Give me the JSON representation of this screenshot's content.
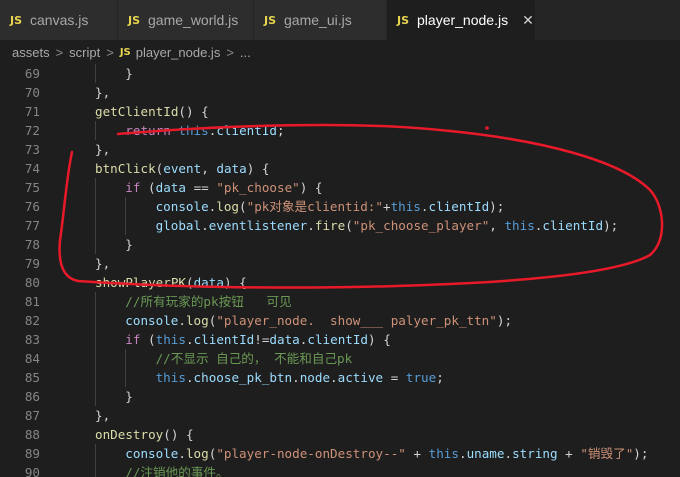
{
  "tabs": [
    {
      "badge": "JS",
      "label": "canvas.js",
      "active": false
    },
    {
      "badge": "JS",
      "label": "game_world.js",
      "active": false
    },
    {
      "badge": "JS",
      "label": "game_ui.js",
      "active": false
    },
    {
      "badge": "JS",
      "label": "player_node.js",
      "active": true,
      "close": "✕"
    }
  ],
  "breadcrumb": {
    "items": [
      "assets",
      "script",
      "player_node.js",
      "..."
    ],
    "separator": ">",
    "badge": "JS"
  },
  "colors": {
    "annotation": "#e81a2a",
    "keyword": "#c586c0",
    "function": "#dcdcaa",
    "string": "#ce9178",
    "comment": "#6a9955",
    "this": "#569cd6",
    "property": "#9cdcfe"
  },
  "code": {
    "lines": [
      {
        "n": "69",
        "indent": 2,
        "tokens": [
          {
            "t": "}",
            "c": "plain"
          }
        ]
      },
      {
        "n": "70",
        "indent": 1,
        "tokens": [
          {
            "t": "},",
            "c": "plain"
          }
        ]
      },
      {
        "n": "71",
        "indent": 1,
        "tokens": [
          {
            "t": "getClientId",
            "c": "fn"
          },
          {
            "t": "() {",
            "c": "plain"
          }
        ]
      },
      {
        "n": "72",
        "indent": 2,
        "tokens": [
          {
            "t": "return",
            "c": "kw"
          },
          {
            "t": " ",
            "c": "plain"
          },
          {
            "t": "this",
            "c": "this"
          },
          {
            "t": ".",
            "c": "plain"
          },
          {
            "t": "clientId",
            "c": "prop"
          },
          {
            "t": ";",
            "c": "plain"
          }
        ]
      },
      {
        "n": "73",
        "indent": 1,
        "tokens": [
          {
            "t": "},",
            "c": "plain"
          }
        ]
      },
      {
        "n": "74",
        "indent": 1,
        "tokens": [
          {
            "t": "btnClick",
            "c": "fn"
          },
          {
            "t": "(",
            "c": "plain"
          },
          {
            "t": "event",
            "c": "prop"
          },
          {
            "t": ", ",
            "c": "plain"
          },
          {
            "t": "data",
            "c": "prop"
          },
          {
            "t": ") {",
            "c": "plain"
          }
        ]
      },
      {
        "n": "75",
        "indent": 2,
        "tokens": [
          {
            "t": "if",
            "c": "kw"
          },
          {
            "t": " (",
            "c": "plain"
          },
          {
            "t": "data",
            "c": "prop"
          },
          {
            "t": " == ",
            "c": "plain"
          },
          {
            "t": "\"pk_choose\"",
            "c": "str"
          },
          {
            "t": ") {",
            "c": "plain"
          }
        ]
      },
      {
        "n": "76",
        "indent": 3,
        "tokens": [
          {
            "t": "console",
            "c": "prop"
          },
          {
            "t": ".",
            "c": "plain"
          },
          {
            "t": "log",
            "c": "fn"
          },
          {
            "t": "(",
            "c": "plain"
          },
          {
            "t": "\"pk对象是clientid:\"",
            "c": "str"
          },
          {
            "t": "+",
            "c": "plain"
          },
          {
            "t": "this",
            "c": "this"
          },
          {
            "t": ".",
            "c": "plain"
          },
          {
            "t": "clientId",
            "c": "prop"
          },
          {
            "t": ");",
            "c": "plain"
          }
        ]
      },
      {
        "n": "77",
        "indent": 3,
        "tokens": [
          {
            "t": "global",
            "c": "prop"
          },
          {
            "t": ".",
            "c": "plain"
          },
          {
            "t": "eventlistener",
            "c": "prop"
          },
          {
            "t": ".",
            "c": "plain"
          },
          {
            "t": "fire",
            "c": "fn"
          },
          {
            "t": "(",
            "c": "plain"
          },
          {
            "t": "\"pk_choose_player\"",
            "c": "str"
          },
          {
            "t": ", ",
            "c": "plain"
          },
          {
            "t": "this",
            "c": "this"
          },
          {
            "t": ".",
            "c": "plain"
          },
          {
            "t": "clientId",
            "c": "prop"
          },
          {
            "t": ");",
            "c": "plain"
          }
        ]
      },
      {
        "n": "78",
        "indent": 2,
        "tokens": [
          {
            "t": "}",
            "c": "plain"
          }
        ]
      },
      {
        "n": "79",
        "indent": 1,
        "tokens": [
          {
            "t": "},",
            "c": "plain"
          }
        ]
      },
      {
        "n": "80",
        "indent": 1,
        "tokens": [
          {
            "t": "showPlayerPK",
            "c": "fn"
          },
          {
            "t": "(",
            "c": "plain"
          },
          {
            "t": "data",
            "c": "prop"
          },
          {
            "t": ") {",
            "c": "plain"
          }
        ]
      },
      {
        "n": "81",
        "indent": 2,
        "tokens": [
          {
            "t": "//所有玩家的pk按钮   可见",
            "c": "com"
          }
        ]
      },
      {
        "n": "82",
        "indent": 2,
        "tokens": [
          {
            "t": "console",
            "c": "prop"
          },
          {
            "t": ".",
            "c": "plain"
          },
          {
            "t": "log",
            "c": "fn"
          },
          {
            "t": "(",
            "c": "plain"
          },
          {
            "t": "\"player_node.  show___ palyer_pk_ttn\"",
            "c": "str"
          },
          {
            "t": ");",
            "c": "plain"
          }
        ]
      },
      {
        "n": "83",
        "indent": 2,
        "tokens": [
          {
            "t": "if",
            "c": "kw"
          },
          {
            "t": " (",
            "c": "plain"
          },
          {
            "t": "this",
            "c": "this"
          },
          {
            "t": ".",
            "c": "plain"
          },
          {
            "t": "clientId",
            "c": "prop"
          },
          {
            "t": "!=",
            "c": "plain"
          },
          {
            "t": "data",
            "c": "prop"
          },
          {
            "t": ".",
            "c": "plain"
          },
          {
            "t": "clientId",
            "c": "prop"
          },
          {
            "t": ") {",
            "c": "plain"
          }
        ]
      },
      {
        "n": "84",
        "indent": 3,
        "tokens": [
          {
            "t": "//不显示 自己的， 不能和自己pk",
            "c": "com"
          }
        ]
      },
      {
        "n": "85",
        "indent": 3,
        "tokens": [
          {
            "t": "this",
            "c": "this"
          },
          {
            "t": ".",
            "c": "plain"
          },
          {
            "t": "choose_pk_btn",
            "c": "prop"
          },
          {
            "t": ".",
            "c": "plain"
          },
          {
            "t": "node",
            "c": "prop"
          },
          {
            "t": ".",
            "c": "plain"
          },
          {
            "t": "active",
            "c": "prop"
          },
          {
            "t": " = ",
            "c": "plain"
          },
          {
            "t": "true",
            "c": "this"
          },
          {
            "t": ";",
            "c": "plain"
          }
        ]
      },
      {
        "n": "86",
        "indent": 2,
        "tokens": [
          {
            "t": "}",
            "c": "plain"
          }
        ]
      },
      {
        "n": "87",
        "indent": 1,
        "tokens": [
          {
            "t": "},",
            "c": "plain"
          }
        ]
      },
      {
        "n": "88",
        "indent": 1,
        "tokens": [
          {
            "t": "onDestroy",
            "c": "fn"
          },
          {
            "t": "() {",
            "c": "plain"
          }
        ]
      },
      {
        "n": "89",
        "indent": 2,
        "tokens": [
          {
            "t": "console",
            "c": "prop"
          },
          {
            "t": ".",
            "c": "plain"
          },
          {
            "t": "log",
            "c": "fn"
          },
          {
            "t": "(",
            "c": "plain"
          },
          {
            "t": "\"player-node-onDestroy--\"",
            "c": "str"
          },
          {
            "t": " + ",
            "c": "plain"
          },
          {
            "t": "this",
            "c": "this"
          },
          {
            "t": ".",
            "c": "plain"
          },
          {
            "t": "uname",
            "c": "prop"
          },
          {
            "t": ".",
            "c": "plain"
          },
          {
            "t": "string",
            "c": "prop"
          },
          {
            "t": " + ",
            "c": "plain"
          },
          {
            "t": "\"销毁了\"",
            "c": "str"
          },
          {
            "t": ");",
            "c": "plain"
          }
        ]
      },
      {
        "n": "90",
        "indent": 2,
        "tokens": [
          {
            "t": "//注销他的事件。",
            "c": "com"
          }
        ]
      }
    ]
  }
}
